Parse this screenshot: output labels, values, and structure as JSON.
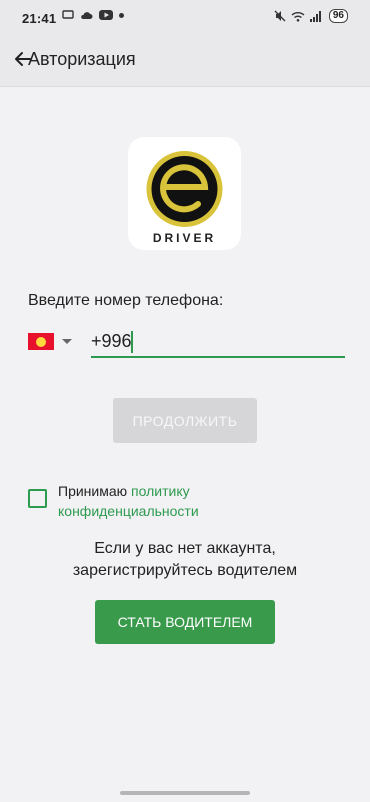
{
  "status_bar": {
    "time": "21:41",
    "battery": "96",
    "icons": [
      "screen-share-icon",
      "cloud-icon",
      "youtube-icon",
      "notification-dot-icon",
      "mute-icon",
      "wifi-icon",
      "signal-icon"
    ]
  },
  "app_bar": {
    "title": "Авторизация",
    "back_icon": "arrow-left-icon"
  },
  "logo": {
    "letter": "e",
    "text": "DRIVER",
    "ring_color": "#d8c33a",
    "circle_color": "#111111"
  },
  "form": {
    "prompt": "Введите номер телефона:",
    "country_flag": "kyrgyzstan-flag",
    "phone_value": "+996",
    "continue_label": "ПРОДОЛЖИТЬ",
    "terms_prefix": "Принимаю ",
    "terms_link_1": "политику",
    "terms_link_2": "конфиденциальности"
  },
  "register": {
    "line1": "Если у вас нет аккаунта,",
    "line2": "зарегистрируйтесь водителем",
    "button_label": "СТАТЬ ВОДИТЕЛЕМ"
  },
  "colors": {
    "accent": "#2e9a4f",
    "button_green": "#3a9a4c",
    "disabled_button": "#d6d6d8"
  }
}
